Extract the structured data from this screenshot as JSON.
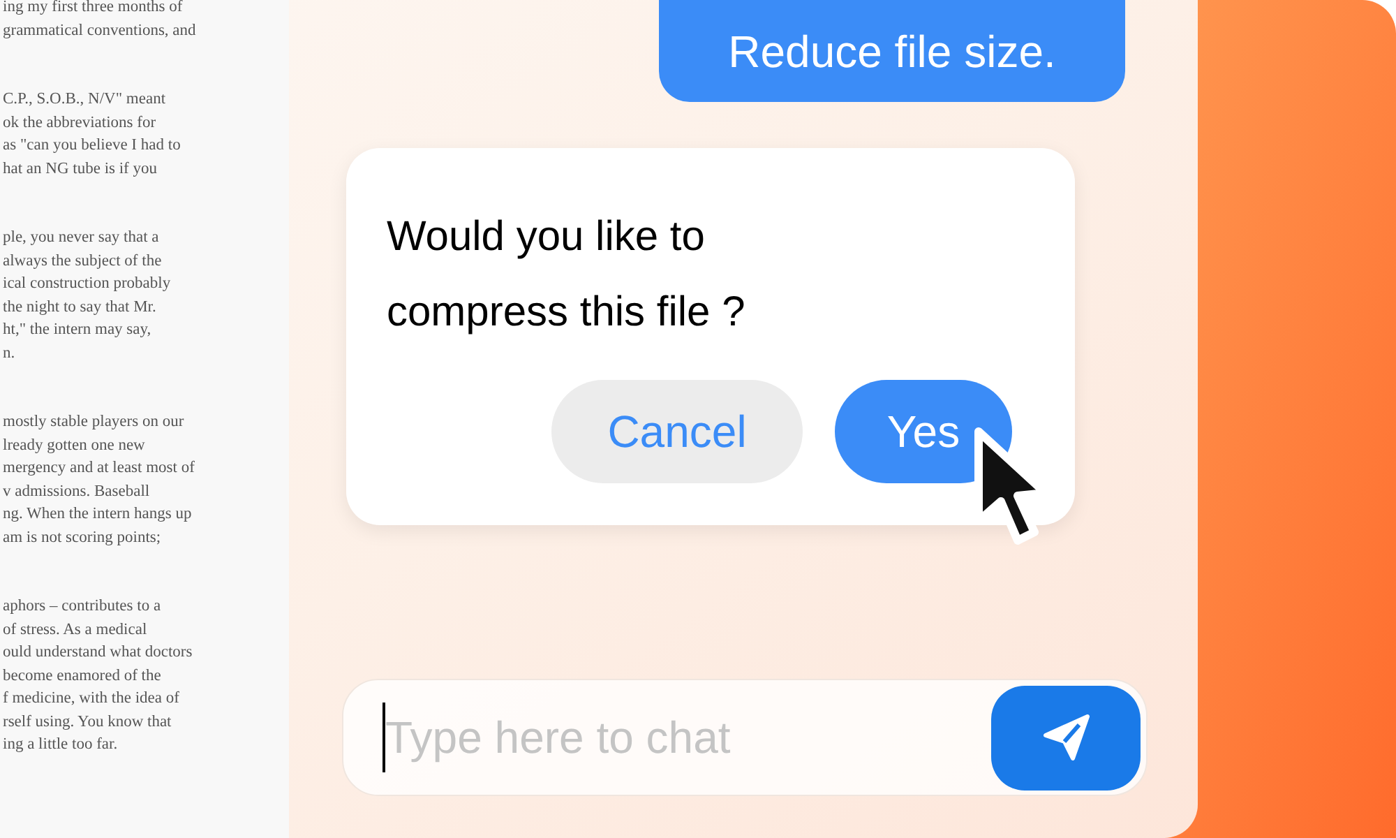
{
  "document": {
    "paragraphs": [
      {
        "lines": [
          "ing my first three months of",
          "grammatical conventions, and"
        ]
      },
      {
        "lines": [
          "C.P., S.O.B., N/V\" meant",
          "ok the abbreviations for",
          "as \"can you believe I had to",
          "hat an NG tube is if you"
        ]
      },
      {
        "lines": [
          "ple, you never say that a",
          "always the subject of the",
          "ical construction probably",
          "the night to say that Mr.",
          "ht,\" the intern may say,",
          "n."
        ]
      },
      {
        "lines": [
          "mostly stable players on our",
          "lready gotten one new",
          "mergency and at least most of",
          "v admissions. Baseball",
          "ng. When the intern hangs up",
          "am is not scoring points;"
        ]
      },
      {
        "lines": [
          "aphors – contributes to a",
          "of stress. As a medical",
          "ould understand what doctors",
          "become enamored of the",
          "f medicine, with the idea of",
          "rself using. You know that",
          "ing a little too far."
        ]
      }
    ]
  },
  "chat": {
    "user_message": "Reduce file size.",
    "prompt": {
      "text": "Would you like to compress this file ?",
      "buttons": [
        {
          "label": "Cancel",
          "kind": "secondary"
        },
        {
          "label": "Yes",
          "kind": "primary"
        }
      ]
    },
    "input": {
      "placeholder": "Type here to chat"
    }
  }
}
